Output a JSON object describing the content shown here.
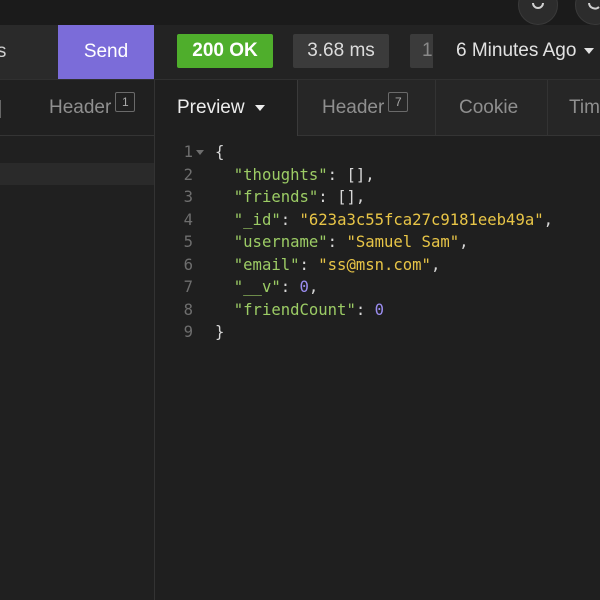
{
  "request_bar": {
    "params_tab_label": "ers",
    "send_label": "Send"
  },
  "response_meta": {
    "status": "200 OK",
    "time": "3.68 ms",
    "size": "1",
    "history": "6 Minutes Ago"
  },
  "request_tabs": {
    "header_label": "Header",
    "header_count": "1"
  },
  "response_tabs": {
    "preview_label": "Preview",
    "header_label": "Header",
    "header_count": "7",
    "cookie_label": "Cookie",
    "timeline_label": "Tim"
  },
  "response_body": [
    {
      "n": "1",
      "indent": "",
      "key": "",
      "value": "",
      "open": "{",
      "close": ""
    },
    {
      "n": "2",
      "indent": "  ",
      "key": "\"thoughts\"",
      "value": "[]",
      "vtype": "pun"
    },
    {
      "n": "3",
      "indent": "  ",
      "key": "\"friends\"",
      "value": "[]",
      "vtype": "pun"
    },
    {
      "n": "4",
      "indent": "  ",
      "key": "\"_id\"",
      "value": "\"623a3c55fca27c9181eeb49a\"",
      "vtype": "str"
    },
    {
      "n": "5",
      "indent": "  ",
      "key": "\"username\"",
      "value": "\"Samuel Sam\"",
      "vtype": "str"
    },
    {
      "n": "6",
      "indent": "  ",
      "key": "\"email\"",
      "value": "\"ss@msn.com\"",
      "vtype": "str"
    },
    {
      "n": "7",
      "indent": "  ",
      "key": "\"__v\"",
      "value": "0",
      "vtype": "num"
    },
    {
      "n": "8",
      "indent": "  ",
      "key": "\"friendCount\"",
      "value": "0",
      "vtype": "num"
    },
    {
      "n": "9",
      "indent": "",
      "key": "",
      "value": "",
      "open": "",
      "close": "}"
    }
  ],
  "icons": {
    "settings": "gear-icon",
    "sync": "sync-icon",
    "dropdown": "chevron-down-icon"
  },
  "colors": {
    "send": "#7b6cd9",
    "status_ok": "#4fae2c",
    "json_key": "#9ccc65",
    "json_string": "#e8c547",
    "json_number": "#9b8df0"
  }
}
